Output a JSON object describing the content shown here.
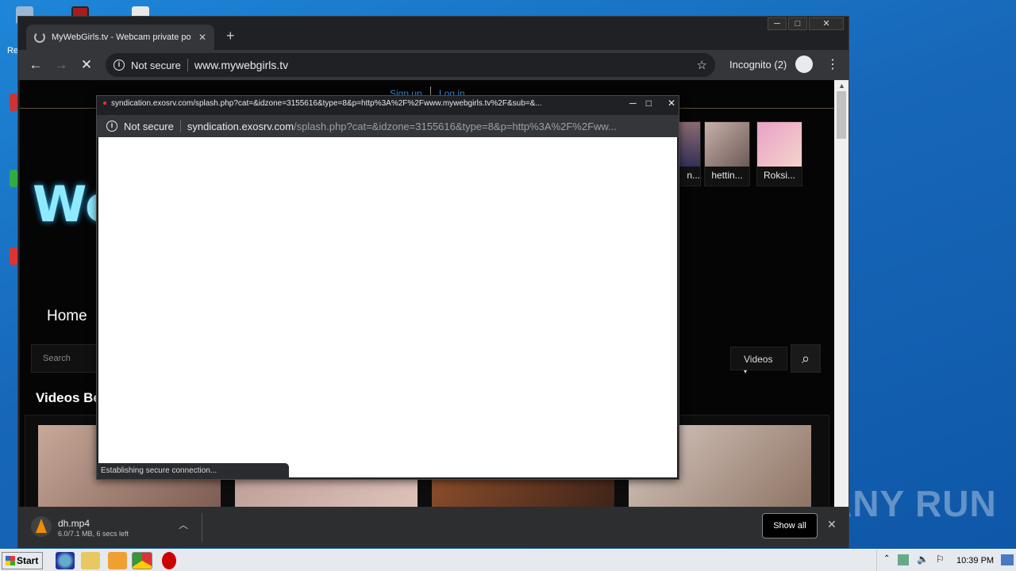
{
  "desktop": {
    "label_re": "Re"
  },
  "browser": {
    "tab_title": "MyWebGirls.tv - Webcam private po",
    "security_label": "Not secure",
    "url": "www.mywebgirls.tv",
    "incognito_label": "Incognito (2)"
  },
  "site": {
    "signup": "Sign up",
    "login": "Log in",
    "logo_text": "We",
    "cams": [
      {
        "name": "n..."
      },
      {
        "name": "hettin..."
      },
      {
        "name": "Roksi..."
      }
    ],
    "nav_home": "Home",
    "search_placeholder": "Search",
    "videos_dropdown": "Videos",
    "videos_heading": "Videos Be"
  },
  "popup": {
    "title": "syndication.exosrv.com/splash.php?cat=&idzone=3155616&type=8&p=http%3A%2F%2Fwww.mywebgirls.tv%2F&sub=&...",
    "security_label": "Not secure",
    "url_host": "syndication.exosrv.com",
    "url_rest": "/splash.php?cat=&idzone=3155616&type=8&p=http%3A%2F%2Fww...",
    "status_text": "Establishing secure connection..."
  },
  "downloads": {
    "filename": "dh.mp4",
    "status": "6.0/7.1 MB, 6 secs left",
    "show_all": "Show all"
  },
  "taskbar": {
    "start_label": "Start",
    "clock": "10:39 PM"
  },
  "watermark": "ANY RUN"
}
